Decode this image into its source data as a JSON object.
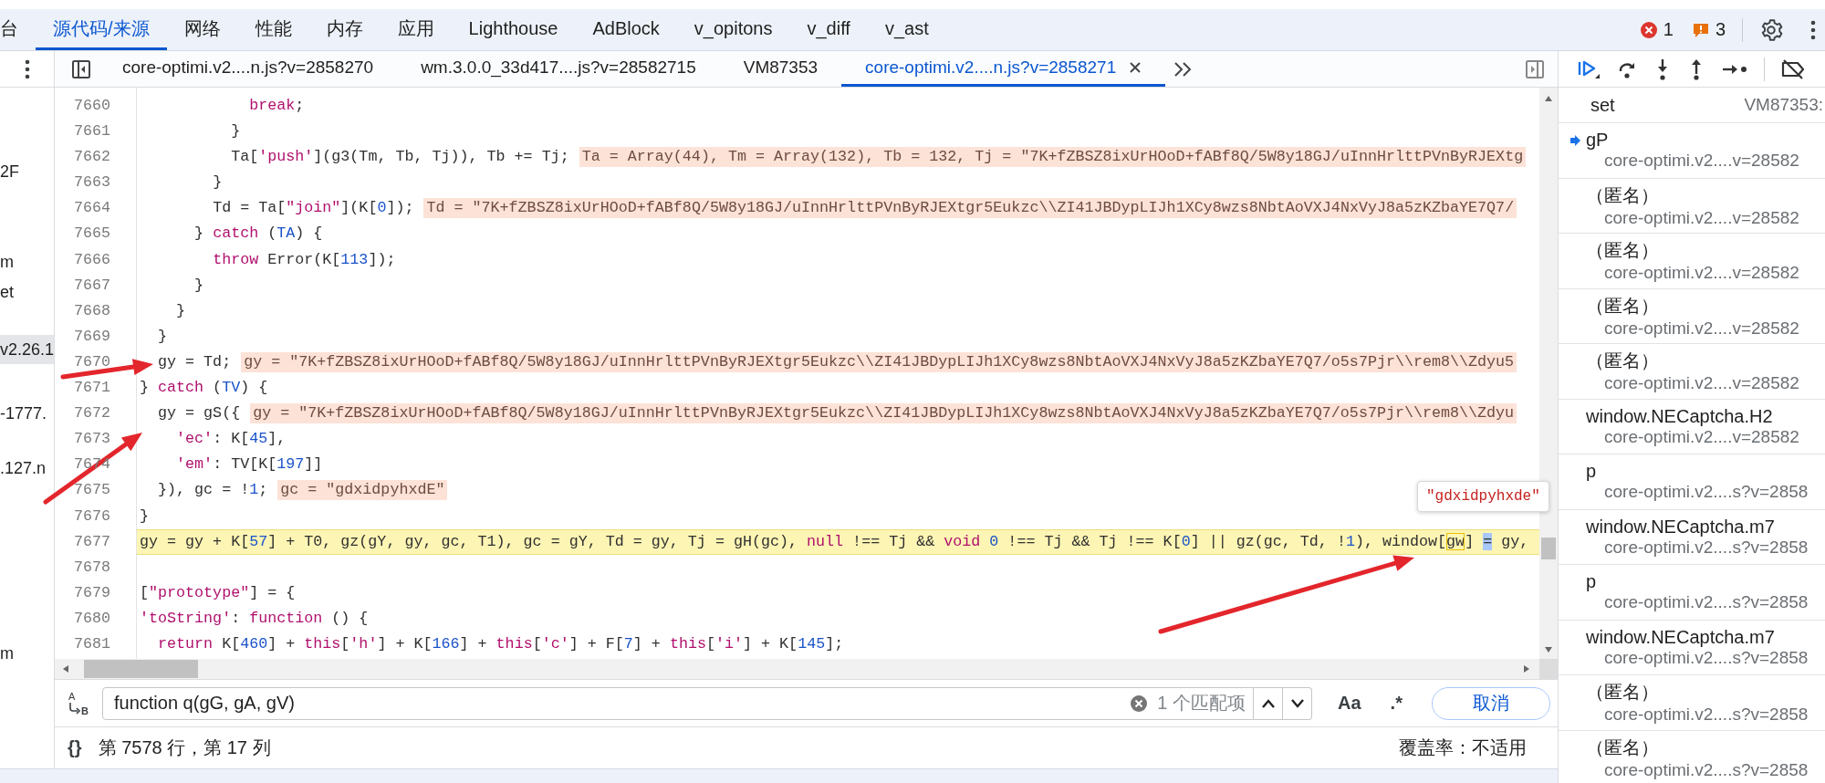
{
  "main_tabs": [
    {
      "label": "台",
      "selected": false
    },
    {
      "label": "源代码/来源",
      "selected": true
    },
    {
      "label": "网络",
      "selected": false
    },
    {
      "label": "性能",
      "selected": false
    },
    {
      "label": "内存",
      "selected": false
    },
    {
      "label": "应用",
      "selected": false
    },
    {
      "label": "Lighthouse",
      "selected": false
    },
    {
      "label": "AdBlock",
      "selected": false
    },
    {
      "label": "v_opitons",
      "selected": false
    },
    {
      "label": "v_diff",
      "selected": false
    },
    {
      "label": "v_ast",
      "selected": false
    }
  ],
  "issues": {
    "errors": "1",
    "warnings": "3"
  },
  "file_tree": [
    {
      "label": "2F",
      "selected": false
    },
    {
      "label": "m",
      "selected": false
    },
    {
      "label": "et",
      "selected": false
    },
    {
      "label": "v2.26.1",
      "selected": true
    },
    {
      "label": "-1777.",
      "selected": false
    },
    {
      "label": ".127.n",
      "selected": false
    },
    {
      "label": "m",
      "selected": false
    }
  ],
  "file_tabs": [
    {
      "label": "core-optimi.v2....n.js?v=2858270",
      "selected": false
    },
    {
      "label": "wm.3.0.0_33d417....js?v=28582715",
      "selected": false
    },
    {
      "label": "VM87353",
      "selected": false
    },
    {
      "label": "core-optimi.v2....n.js?v=2858271",
      "selected": true
    }
  ],
  "editor": {
    "lines": [
      {
        "num": "7660",
        "current": false,
        "tokens": [
          {
            "t": "            break",
            "kind": "kw"
          },
          {
            "t": ";",
            "kind": "p"
          }
        ]
      },
      {
        "num": "7661",
        "current": false,
        "tokens": [
          {
            "t": "          }",
            "kind": "p"
          }
        ]
      },
      {
        "num": "7662",
        "current": false,
        "tokens": [
          {
            "t": "          Ta[",
            "kind": "p"
          },
          {
            "t": "'push'",
            "kind": "str"
          },
          {
            "t": "](g3(Tm, Tb, Tj)), Tb += Tj;",
            "kind": "p"
          }
        ],
        "inline_value": "Ta = Array(44), Tm = Array(132), Tb = 132, Tj = \"7K+fZBSZ8ixUrHOoD+fABf8Q/5W8y18GJ/uInnHrlttPVnByRJEXtg"
      },
      {
        "num": "7663",
        "current": false,
        "tokens": [
          {
            "t": "        }",
            "kind": "p"
          }
        ]
      },
      {
        "num": "7664",
        "current": false,
        "tokens": [
          {
            "t": "        Td = Ta[",
            "kind": "p"
          },
          {
            "t": "\"join\"",
            "kind": "str"
          },
          {
            "t": "](K[",
            "kind": "p"
          },
          {
            "t": "0",
            "kind": "num"
          },
          {
            "t": "]);",
            "kind": "p"
          }
        ],
        "inline_value": "Td = \"7K+fZBSZ8ixUrHOoD+fABf8Q/5W8y18GJ/uInnHrlttPVnByRJEXtgr5Eukzc\\\\ZI41JBDypLIJh1XCy8wzs8NbtAoVXJ4NxVyJ8a5zKZbaYE7Q7/"
      },
      {
        "num": "7665",
        "current": false,
        "tokens": [
          {
            "t": "      } ",
            "kind": "p"
          },
          {
            "t": "catch",
            "kind": "kw"
          },
          {
            "t": " (",
            "kind": "p"
          },
          {
            "t": "TA",
            "kind": "var"
          },
          {
            "t": ") {",
            "kind": "p"
          }
        ]
      },
      {
        "num": "7666",
        "current": false,
        "tokens": [
          {
            "t": "        throw",
            "kind": "kw"
          },
          {
            "t": " Error(K[",
            "kind": "p"
          },
          {
            "t": "113",
            "kind": "num"
          },
          {
            "t": "]);",
            "kind": "p"
          }
        ]
      },
      {
        "num": "7667",
        "current": false,
        "tokens": [
          {
            "t": "      }",
            "kind": "p"
          }
        ]
      },
      {
        "num": "7668",
        "current": false,
        "tokens": [
          {
            "t": "    }",
            "kind": "p"
          }
        ]
      },
      {
        "num": "7669",
        "current": false,
        "tokens": [
          {
            "t": "  }",
            "kind": "p"
          }
        ]
      },
      {
        "num": "7670",
        "current": false,
        "tokens": [
          {
            "t": "  gy = Td;",
            "kind": "p"
          }
        ],
        "inline_value": "gy = \"7K+fZBSZ8ixUrHOoD+fABf8Q/5W8y18GJ/uInnHrlttPVnByRJEXtgr5Eukzc\\\\ZI41JBDypLIJh1XCy8wzs8NbtAoVXJ4NxVyJ8a5zKZbaYE7Q7/o5s7Pjr\\\\rem8\\\\Zdyu5"
      },
      {
        "num": "7671",
        "current": false,
        "tokens": [
          {
            "t": "} ",
            "kind": "p"
          },
          {
            "t": "catch",
            "kind": "kw"
          },
          {
            "t": " (",
            "kind": "p"
          },
          {
            "t": "TV",
            "kind": "var"
          },
          {
            "t": ") {",
            "kind": "p"
          }
        ]
      },
      {
        "num": "7672",
        "current": false,
        "tokens": [
          {
            "t": "  gy = gS({",
            "kind": "p"
          }
        ],
        "inline_value": "gy = \"7K+fZBSZ8ixUrHOoD+fABf8Q/5W8y18GJ/uInnHrlttPVnByRJEXtgr5Eukzc\\\\ZI41JBDypLIJh1XCy8wzs8NbtAoVXJ4NxVyJ8a5zKZbaYE7Q7/o5s7Pjr\\\\rem8\\\\Zdyu"
      },
      {
        "num": "7673",
        "current": false,
        "tokens": [
          {
            "t": "    'ec'",
            "kind": "str"
          },
          {
            "t": ": K[",
            "kind": "p"
          },
          {
            "t": "45",
            "kind": "num"
          },
          {
            "t": "],",
            "kind": "p"
          }
        ]
      },
      {
        "num": "7674",
        "current": false,
        "tokens": [
          {
            "t": "    'em'",
            "kind": "str"
          },
          {
            "t": ": TV[K[",
            "kind": "p"
          },
          {
            "t": "197",
            "kind": "num"
          },
          {
            "t": "]]",
            "kind": "p"
          }
        ]
      },
      {
        "num": "7675",
        "current": false,
        "tokens": [
          {
            "t": "  }), gc = !",
            "kind": "p"
          },
          {
            "t": "1",
            "kind": "num"
          },
          {
            "t": ";",
            "kind": "p"
          }
        ],
        "inline_value": "gc = \"gdxidpyhxdE\""
      },
      {
        "num": "7676",
        "current": false,
        "tokens": [
          {
            "t": "}",
            "kind": "p"
          }
        ]
      },
      {
        "num": "7677",
        "current": true,
        "tokens": [
          {
            "t": "gy = gy + K[",
            "kind": "p"
          },
          {
            "t": "57",
            "kind": "num"
          },
          {
            "t": "] + T0, gz(gY, gy, gc, T1), gc = gY, Td = gy, Tj = gH(gc), ",
            "kind": "p"
          },
          {
            "t": "null",
            "kind": "kw"
          },
          {
            "t": " !== Tj && ",
            "kind": "p"
          },
          {
            "t": "void",
            "kind": "kw"
          },
          {
            "t": " 0",
            "kind": "num"
          },
          {
            "t": " !== Tj && Tj !== K[",
            "kind": "p"
          },
          {
            "t": "0",
            "kind": "num"
          },
          {
            "t": "] || gz(gc, Td, !",
            "kind": "p"
          },
          {
            "t": "1",
            "kind": "num"
          },
          {
            "t": "), window[",
            "kind": "p"
          },
          {
            "t": "gw",
            "kind": "hover"
          },
          {
            "t": "] ",
            "kind": "p"
          },
          {
            "t": "=",
            "kind": "sel"
          },
          {
            "t": " gy,",
            "kind": "p"
          }
        ]
      },
      {
        "num": "7678",
        "current": false
      },
      {
        "num": "7679",
        "current": false,
        "tokens": [
          {
            "t": "[",
            "kind": "p"
          },
          {
            "t": "\"prototype\"",
            "kind": "str"
          },
          {
            "t": "] = {",
            "kind": "p"
          }
        ]
      },
      {
        "num": "7680",
        "current": false,
        "tokens": [
          {
            "t": "'toString'",
            "kind": "str"
          },
          {
            "t": ": ",
            "kind": "p"
          },
          {
            "t": "function",
            "kind": "kw"
          },
          {
            "t": " () {",
            "kind": "p"
          }
        ]
      },
      {
        "num": "7681",
        "current": false,
        "tokens": [
          {
            "t": "  return",
            "kind": "kw"
          },
          {
            "t": " K[",
            "kind": "p"
          },
          {
            "t": "460",
            "kind": "num"
          },
          {
            "t": "] + ",
            "kind": "p"
          },
          {
            "t": "this",
            "kind": "kw"
          },
          {
            "t": "[",
            "kind": "p"
          },
          {
            "t": "'h'",
            "kind": "str"
          },
          {
            "t": "] + K[",
            "kind": "p"
          },
          {
            "t": "166",
            "kind": "num"
          },
          {
            "t": "] + ",
            "kind": "p"
          },
          {
            "t": "this",
            "kind": "kw"
          },
          {
            "t": "[",
            "kind": "p"
          },
          {
            "t": "'c'",
            "kind": "str"
          },
          {
            "t": "] + F[",
            "kind": "p"
          },
          {
            "t": "7",
            "kind": "num"
          },
          {
            "t": "] + ",
            "kind": "p"
          },
          {
            "t": "this",
            "kind": "kw"
          },
          {
            "t": "[",
            "kind": "p"
          },
          {
            "t": "'i'",
            "kind": "str"
          },
          {
            "t": "] + K[",
            "kind": "p"
          },
          {
            "t": "145",
            "kind": "num"
          },
          {
            "t": "];",
            "kind": "p"
          }
        ]
      }
    ],
    "tooltip": "\"gdxidpyhxde\""
  },
  "search": {
    "toggle_letters": [
      "A",
      "B"
    ],
    "value": "function q(gG, gA, gV)",
    "match_count": "1 个匹配项",
    "case_label": "Aa",
    "regex_label": ".*",
    "cancel": "取消"
  },
  "status_bar": {
    "format": "{}",
    "position": "第 7578 行，第 17 列",
    "coverage": "覆盖率：不适用"
  },
  "call_stack": [
    {
      "kind": "single",
      "name": "set",
      "location": "VM87353:",
      "selected": false
    },
    {
      "kind": "double",
      "name": "gP",
      "location": "core-optimi.v2....v=28582",
      "selected": true
    },
    {
      "kind": "double",
      "name": "（匿名）",
      "location": "core-optimi.v2....v=28582",
      "selected": false
    },
    {
      "kind": "double",
      "name": "（匿名）",
      "location": "core-optimi.v2....v=28582",
      "selected": false
    },
    {
      "kind": "double",
      "name": "（匿名）",
      "location": "core-optimi.v2....v=28582",
      "selected": false
    },
    {
      "kind": "double",
      "name": "（匿名）",
      "location": "core-optimi.v2....v=28582",
      "selected": false
    },
    {
      "kind": "double",
      "name": "window.NECaptcha.H2",
      "location": "core-optimi.v2....v=28582",
      "selected": false
    },
    {
      "kind": "double",
      "name": "p",
      "location": "core-optimi.v2....s?v=2858",
      "selected": false
    },
    {
      "kind": "double",
      "name": "window.NECaptcha.m7",
      "location": "core-optimi.v2....s?v=2858",
      "selected": false
    },
    {
      "kind": "double",
      "name": "p",
      "location": "core-optimi.v2....s?v=2858",
      "selected": false
    },
    {
      "kind": "double",
      "name": "window.NECaptcha.m7",
      "location": "core-optimi.v2....s?v=2858",
      "selected": false
    },
    {
      "kind": "double",
      "name": "（匿名）",
      "location": "core-optimi.v2....s?v=2858",
      "selected": false
    },
    {
      "kind": "double",
      "name": "（匿名）",
      "location": "core-optimi.v2....s?v=2858",
      "selected": false
    }
  ]
}
